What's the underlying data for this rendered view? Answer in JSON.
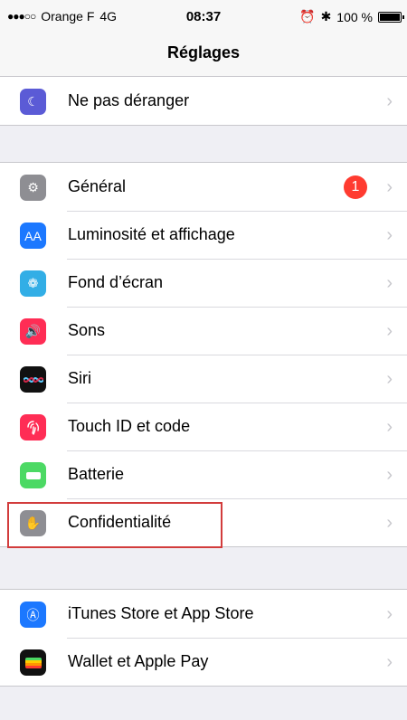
{
  "status": {
    "carrier": "Orange F",
    "network": "4G",
    "time": "08:37",
    "battery_text": "100 %",
    "dots": "●●●○○"
  },
  "nav": {
    "title": "Réglages"
  },
  "groups": [
    {
      "items": [
        {
          "label": "Ne pas déranger",
          "icon": "moon-icon",
          "color": "#5b5bd6"
        }
      ]
    },
    {
      "items": [
        {
          "label": "Général",
          "icon": "gear-icon",
          "color": "#8e8e93",
          "badge": "1"
        },
        {
          "label": "Luminosité et affichage",
          "icon": "aa-icon",
          "color": "#1c78ff",
          "icon_text": "AA"
        },
        {
          "label": "Fond d’écran",
          "icon": "flower-icon",
          "color": "#32aee6"
        },
        {
          "label": "Sons",
          "icon": "speaker-icon",
          "color": "#ff2d55"
        },
        {
          "label": "Siri",
          "icon": "siri-icon",
          "color": "#111111"
        },
        {
          "label": "Touch ID et code",
          "icon": "fingerprint-icon",
          "color": "#ff2d55"
        },
        {
          "label": "Batterie",
          "icon": "battery-icon",
          "color": "#4cd964"
        },
        {
          "label": "Confidentialité",
          "icon": "hand-icon",
          "color": "#8e8e93"
        }
      ]
    },
    {
      "items": [
        {
          "label": "iTunes Store et App Store",
          "icon": "appstore-icon",
          "color": "#1c78ff"
        },
        {
          "label": "Wallet et Apple Pay",
          "icon": "wallet-icon",
          "color": "#111111"
        }
      ]
    }
  ],
  "highlight": {
    "label": "Confidentialité",
    "color": "#d23c3c"
  }
}
